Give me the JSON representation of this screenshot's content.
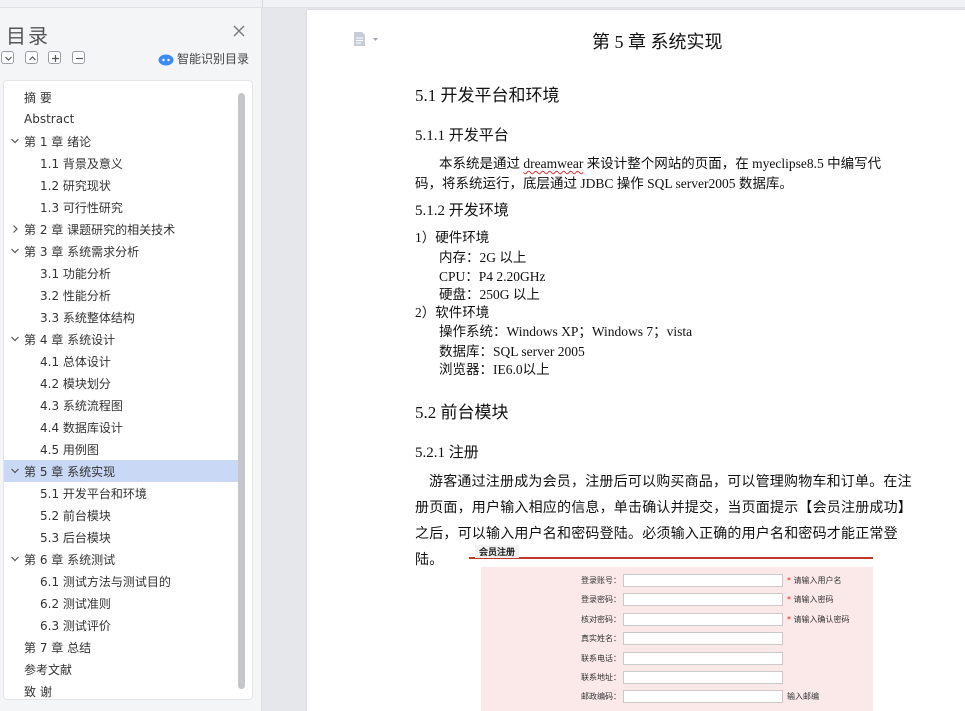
{
  "sidebar": {
    "title": "目录",
    "ai_button_label": "智能识别目录",
    "items": [
      {
        "label": "摘  要",
        "level": 1,
        "expander": "none",
        "active": false
      },
      {
        "label": "Abstract",
        "level": 1,
        "expander": "none",
        "active": false
      },
      {
        "label": "第 1 章  绪论",
        "level": 1,
        "expander": "expanded",
        "active": false
      },
      {
        "label": "1.1 背景及意义",
        "level": 2,
        "expander": "none",
        "active": false
      },
      {
        "label": "1.2  研究现状",
        "level": 2,
        "expander": "none",
        "active": false
      },
      {
        "label": "1.3  可行性研究",
        "level": 2,
        "expander": "none",
        "active": false
      },
      {
        "label": "第 2 章  课题研究的相关技术",
        "level": 1,
        "expander": "collapsed",
        "active": false
      },
      {
        "label": "第 3 章  系统需求分析",
        "level": 1,
        "expander": "expanded",
        "active": false
      },
      {
        "label": "3.1  功能分析",
        "level": 2,
        "expander": "none",
        "active": false
      },
      {
        "label": "3.2  性能分析",
        "level": 2,
        "expander": "none",
        "active": false
      },
      {
        "label": "3.3  系统整体结构",
        "level": 2,
        "expander": "none",
        "active": false
      },
      {
        "label": "第 4 章  系统设计",
        "level": 1,
        "expander": "expanded",
        "active": false
      },
      {
        "label": "4.1  总体设计",
        "level": 2,
        "expander": "none",
        "active": false
      },
      {
        "label": "4.2  模块划分",
        "level": 2,
        "expander": "none",
        "active": false
      },
      {
        "label": "4.3 系统流程图",
        "level": 2,
        "expander": "none",
        "active": false
      },
      {
        "label": "4.4  数据库设计",
        "level": 2,
        "expander": "none",
        "active": false
      },
      {
        "label": "4.5  用例图",
        "level": 2,
        "expander": "none",
        "active": false
      },
      {
        "label": "第 5 章  系统实现",
        "level": 1,
        "expander": "expanded",
        "active": true
      },
      {
        "label": "5.1  开发平台和环境",
        "level": 2,
        "expander": "none",
        "active": false
      },
      {
        "label": "5.2  前台模块",
        "level": 2,
        "expander": "none",
        "active": false
      },
      {
        "label": "5.3  后台模块",
        "level": 2,
        "expander": "none",
        "active": false
      },
      {
        "label": "第 6 章  系统测试",
        "level": 1,
        "expander": "expanded",
        "active": false
      },
      {
        "label": "6.1  测试方法与测试目的",
        "level": 2,
        "expander": "none",
        "active": false
      },
      {
        "label": "6.2  测试准则",
        "level": 2,
        "expander": "none",
        "active": false
      },
      {
        "label": "6.3  测试评价",
        "level": 2,
        "expander": "none",
        "active": false
      },
      {
        "label": "第 7 章  总结",
        "level": 1,
        "expander": "none",
        "active": false
      },
      {
        "label": "参考文献",
        "level": 1,
        "expander": "none",
        "active": false
      },
      {
        "label": "致  谢",
        "level": 1,
        "expander": "none",
        "active": false
      }
    ]
  },
  "document": {
    "chapter_title": "第 5 章  系统实现",
    "s51_heading": "5.1  开发平台和环境",
    "s511_heading": "5.1.1  开发平台",
    "s511_text_a": "本系统是通过 ",
    "s511_text_word": "dreamwear",
    "s511_text_b": " 来设计整个网站的页面，在 myeclipse8.5 中编写代",
    "s511_text_c": "码，将系统运行，底层通过 JDBC 操作 SQL server2005 数据库。",
    "s512_heading": "5.1.2  开发环境",
    "hw_title": "1）硬件环境",
    "hw_mem": "内存：2G 以上",
    "hw_cpu": "CPU：P4    2.20GHz",
    "hw_disk": "硬盘：250G 以上",
    "sw_title": "2）软件环境",
    "sw_os": "操作系统：Windows XP；Windows 7；vista",
    "sw_db": "数据库：SQL server 2005",
    "sw_browser": "浏览器：IE6.0以上",
    "s52_heading": "5.2  前台模块",
    "s521_heading": "5.2.1 注册",
    "s521_text": "游客通过注册成为会员，注册后可以购买商品，可以管理购物车和订单。在注册页面，用户输入相应的信息，单击确认并提交，当页面提示【会员注册成功】之后，可以输入用户名和密码登陆。必须输入正确的用户名和密码才能正常登陆。"
  },
  "register_form": {
    "title": "会员注册",
    "rows": [
      {
        "label": "登录账号：",
        "star": "*",
        "hint": "请输入用户名"
      },
      {
        "label": "登录密码：",
        "star": "*",
        "hint": "请输入密码"
      },
      {
        "label": "核对密码：",
        "star": "*",
        "hint": "请输入确认密码"
      },
      {
        "label": "真实姓名：",
        "star": "",
        "hint": ""
      },
      {
        "label": "联系电话：",
        "star": "",
        "hint": ""
      },
      {
        "label": "联系地址：",
        "star": "",
        "hint": ""
      },
      {
        "label": "邮政编码：",
        "star": "",
        "hint": "输入邮编"
      }
    ]
  },
  "colors": {
    "active_item_bg": "#c9d8f4",
    "form_bg": "#fbe9e9",
    "form_accent": "#c0392b"
  },
  "icons": {
    "close": "close-icon",
    "expand_all": "chevron-down-icon",
    "collapse_all": "chevron-up-icon",
    "add": "plus-icon",
    "remove": "minus-icon",
    "ai": "cloud-icon",
    "doc": "document-icon"
  }
}
